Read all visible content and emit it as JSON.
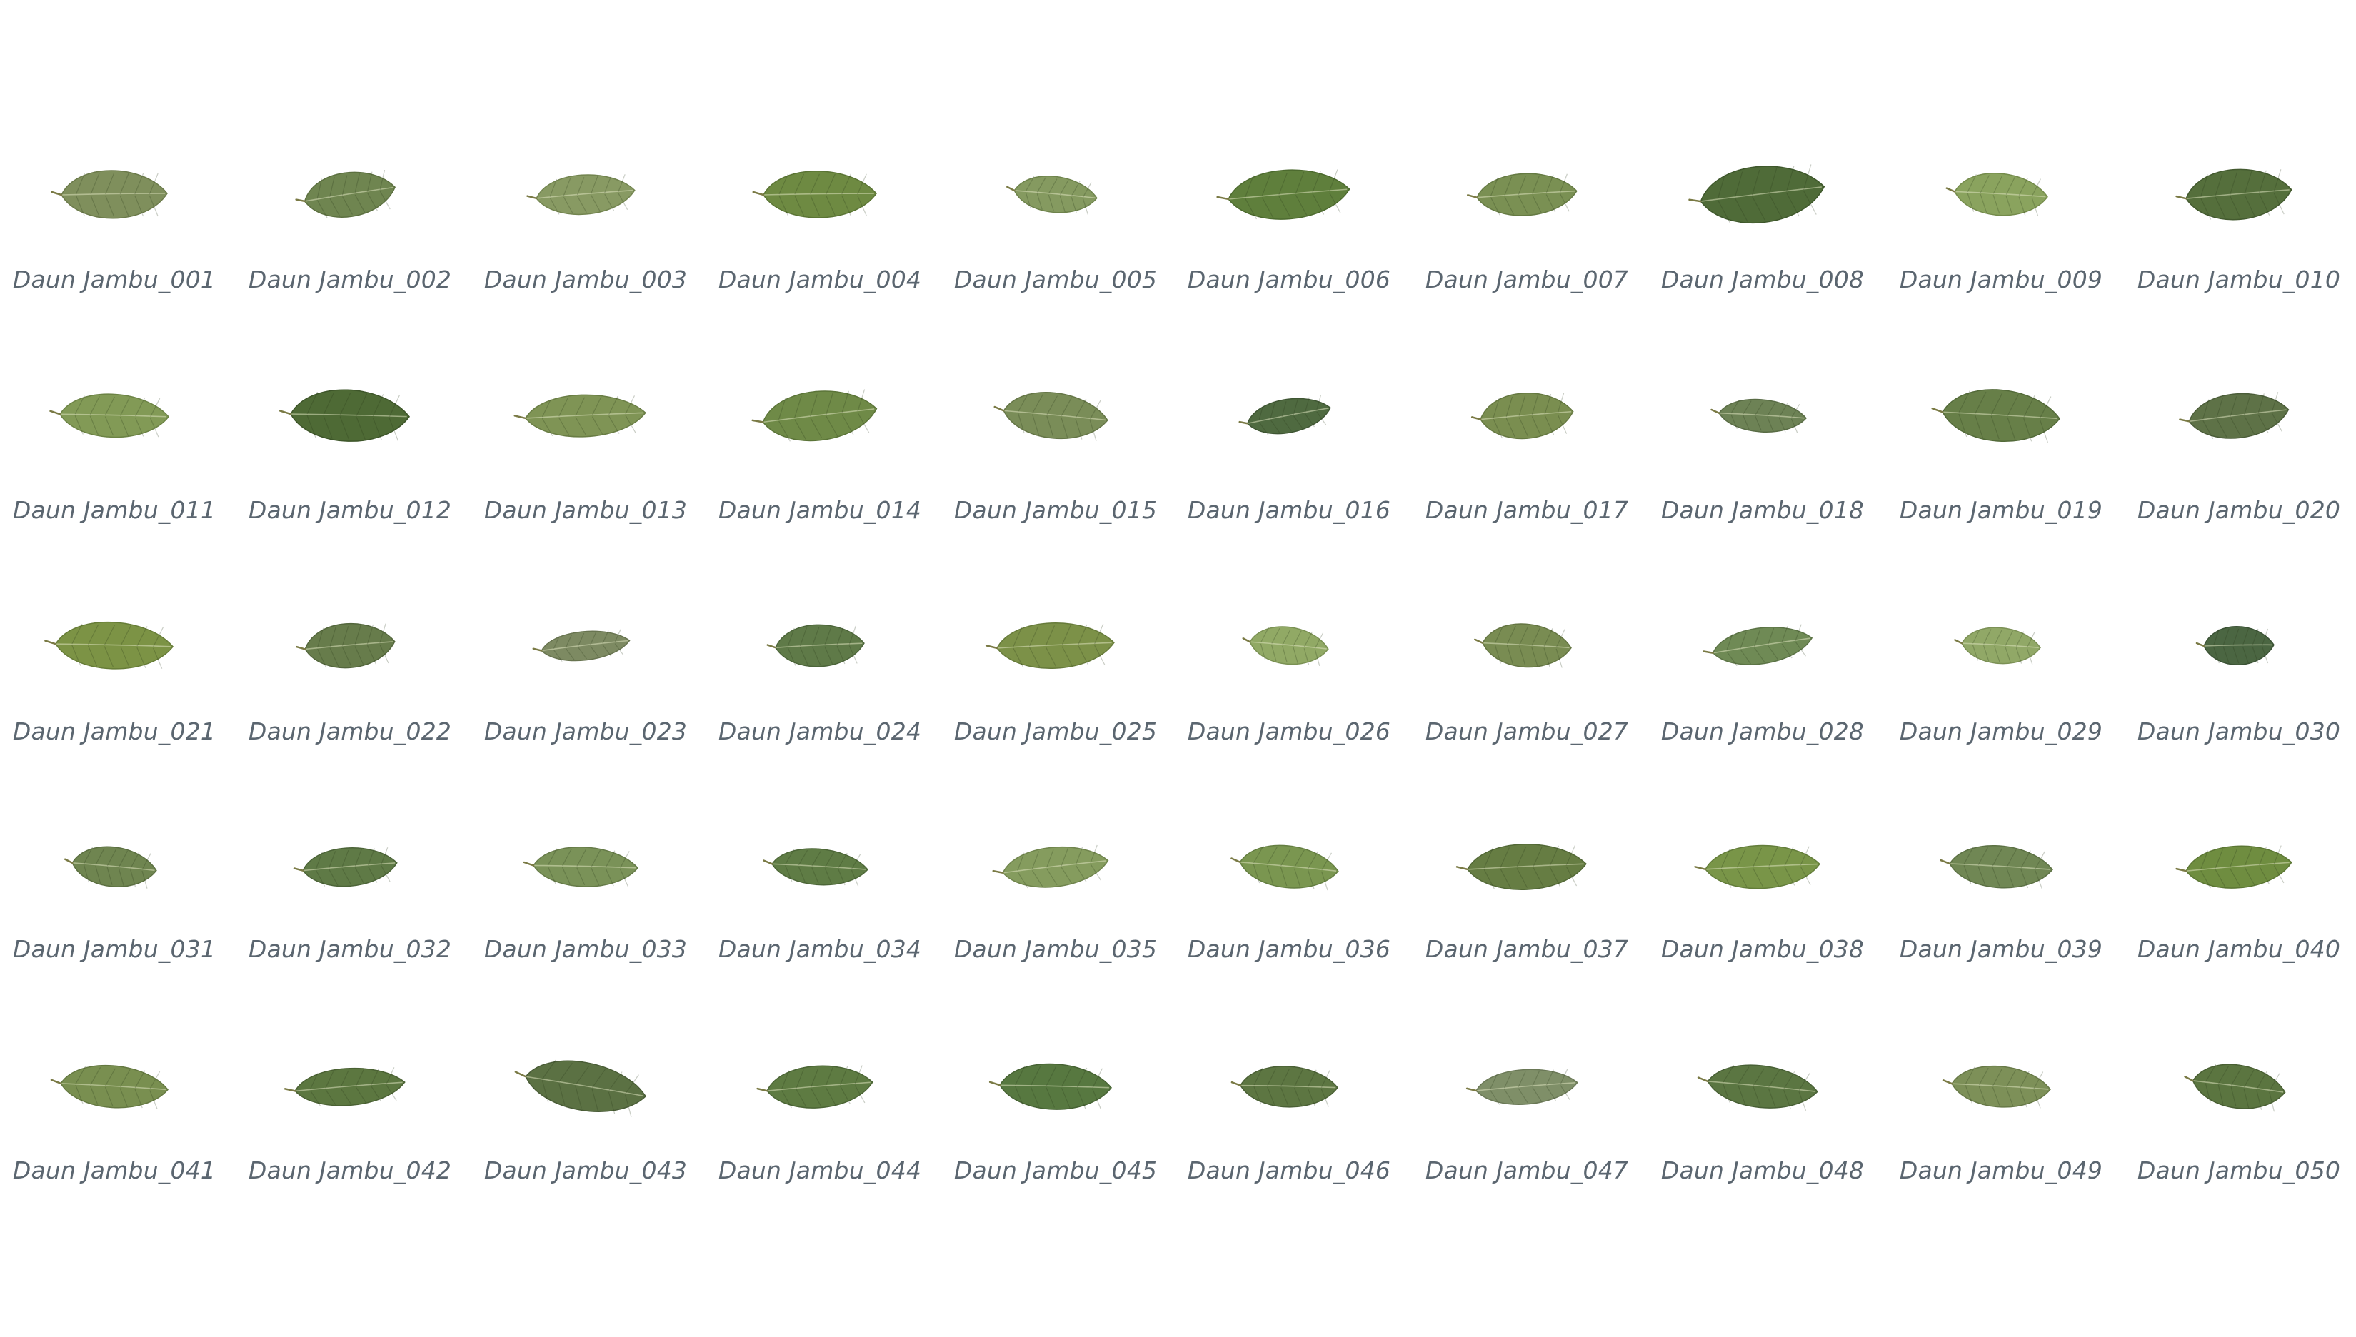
{
  "gallery": {
    "leaf_icon": "leaf-photo",
    "items": [
      {
        "label": "Daun Jambu_001",
        "color": "#7f8f5c",
        "shade": "#6b7a4a"
      },
      {
        "label": "Daun Jambu_002",
        "color": "#6f8550",
        "shade": "#5c7040"
      },
      {
        "label": "Daun Jambu_003",
        "color": "#889a63",
        "shade": "#72844f"
      },
      {
        "label": "Daun Jambu_004",
        "color": "#6e8a42",
        "shade": "#5a7434"
      },
      {
        "label": "Daun Jambu_005",
        "color": "#859a60",
        "shade": "#6e834c"
      },
      {
        "label": "Daun Jambu_006",
        "color": "#5f7f3c",
        "shade": "#4c6a2e"
      },
      {
        "label": "Daun Jambu_007",
        "color": "#7a9053",
        "shade": "#657a43"
      },
      {
        "label": "Daun Jambu_008",
        "color": "#4f6b38",
        "shade": "#3e572b"
      },
      {
        "label": "Daun Jambu_009",
        "color": "#8aa35e",
        "shade": "#748b4b"
      },
      {
        "label": "Daun Jambu_010",
        "color": "#556f3c",
        "shade": "#435a2f"
      },
      {
        "label": "Daun Jambu_011",
        "color": "#829a56",
        "shade": "#6c8345"
      },
      {
        "label": "Daun Jambu_012",
        "color": "#4e6a35",
        "shade": "#3d5529"
      },
      {
        "label": "Daun Jambu_013",
        "color": "#7f9455",
        "shade": "#697d44"
      },
      {
        "label": "Daun Jambu_014",
        "color": "#6f8a47",
        "shade": "#5b7438"
      },
      {
        "label": "Daun Jambu_015",
        "color": "#7a8d58",
        "shade": "#657647"
      },
      {
        "label": "Daun Jambu_016",
        "color": "#4f6a40",
        "shade": "#3f5633"
      },
      {
        "label": "Daun Jambu_017",
        "color": "#7a8e50",
        "shade": "#657841"
      },
      {
        "label": "Daun Jambu_018",
        "color": "#6d8255",
        "shade": "#596c45"
      },
      {
        "label": "Daun Jambu_019",
        "color": "#677f48",
        "shade": "#536a39"
      },
      {
        "label": "Daun Jambu_020",
        "color": "#5e7247",
        "shade": "#4b5d39"
      },
      {
        "label": "Daun Jambu_021",
        "color": "#7c9345",
        "shade": "#667c37"
      },
      {
        "label": "Daun Jambu_022",
        "color": "#677c4b",
        "shade": "#53663c"
      },
      {
        "label": "Daun Jambu_023",
        "color": "#7d8a62",
        "shade": "#687450"
      },
      {
        "label": "Daun Jambu_024",
        "color": "#5f7a48",
        "shade": "#4c653a"
      },
      {
        "label": "Daun Jambu_025",
        "color": "#7c9148",
        "shade": "#667a3a"
      },
      {
        "label": "Daun Jambu_026",
        "color": "#91a965",
        "shade": "#7a9153"
      },
      {
        "label": "Daun Jambu_027",
        "color": "#798c52",
        "shade": "#647542"
      },
      {
        "label": "Daun Jambu_028",
        "color": "#6f8a55",
        "shade": "#5b7345"
      },
      {
        "label": "Daun Jambu_029",
        "color": "#91a867",
        "shade": "#7b9055"
      },
      {
        "label": "Daun Jambu_030",
        "color": "#4b6642",
        "shade": "#3b5235"
      },
      {
        "label": "Daun Jambu_031",
        "color": "#6f8550",
        "shade": "#5b6f41"
      },
      {
        "label": "Daun Jambu_032",
        "color": "#5f7a46",
        "shade": "#4c6438"
      },
      {
        "label": "Daun Jambu_033",
        "color": "#7a9258",
        "shade": "#657a47"
      },
      {
        "label": "Daun Jambu_034",
        "color": "#5f7c45",
        "shade": "#4c6637"
      },
      {
        "label": "Daun Jambu_035",
        "color": "#859c5e",
        "shade": "#6f844c"
      },
      {
        "label": "Daun Jambu_036",
        "color": "#7a9650",
        "shade": "#647e41"
      },
      {
        "label": "Daun Jambu_037",
        "color": "#667d43",
        "shade": "#526836"
      },
      {
        "label": "Daun Jambu_038",
        "color": "#799548",
        "shade": "#637d3a"
      },
      {
        "label": "Daun Jambu_039",
        "color": "#708754",
        "shade": "#5c7144"
      },
      {
        "label": "Daun Jambu_040",
        "color": "#6f8d40",
        "shade": "#5b7633"
      },
      {
        "label": "Daun Jambu_041",
        "color": "#798f50",
        "shade": "#647841"
      },
      {
        "label": "Daun Jambu_042",
        "color": "#5c7740",
        "shade": "#4a6133"
      },
      {
        "label": "Daun Jambu_043",
        "color": "#5b7143",
        "shade": "#495c36"
      },
      {
        "label": "Daun Jambu_044",
        "color": "#5e7b42",
        "shade": "#4b6535"
      },
      {
        "label": "Daun Jambu_045",
        "color": "#577840",
        "shade": "#466233"
      },
      {
        "label": "Daun Jambu_046",
        "color": "#5d7642",
        "shade": "#4a6035"
      },
      {
        "label": "Daun Jambu_047",
        "color": "#7f8f68",
        "shade": "#6a7856"
      },
      {
        "label": "Daun Jambu_048",
        "color": "#5b7642",
        "shade": "#486035"
      },
      {
        "label": "Daun Jambu_049",
        "color": "#7d9058",
        "shade": "#677947"
      },
      {
        "label": "Daun Jambu_050",
        "color": "#5b7540",
        "shade": "#495f33"
      }
    ]
  }
}
